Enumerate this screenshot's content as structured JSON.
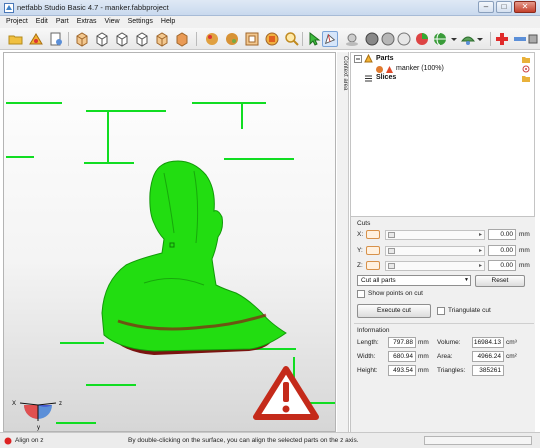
{
  "window": {
    "title": "netfabb Studio Basic 4.7 - manker.fabbproject",
    "buttons": {
      "minimize": "–",
      "maximize": "□",
      "close": "✕"
    }
  },
  "menu": {
    "items": [
      "Project",
      "Edit",
      "Part",
      "Extras",
      "View",
      "Settings",
      "Help"
    ]
  },
  "toolbar": {
    "icons": [
      "open-folder-icon",
      "add-part-icon",
      "new-project-icon",
      "view-front-icon",
      "view-back-icon",
      "view-left-icon",
      "view-right-icon",
      "view-top-icon",
      "view-bottom-icon",
      "repair-icon",
      "measure-icon",
      "slice-icon",
      "analysis-icon",
      "zoom-icon",
      "select-arrow-icon",
      "pointer-icon",
      "shading-icon",
      "solid-icon",
      "texture-icon",
      "wire-icon",
      "color-sphere-icon",
      "globe-icon",
      "palette-icon",
      "add-icon",
      "remove-icon",
      "settings-icon"
    ]
  },
  "sidebar_tab": {
    "label": "Context area"
  },
  "tree": {
    "parts_label": "Parts",
    "part_item": "manker (100%)",
    "slices_label": "Slices"
  },
  "cuts": {
    "heading": "Cuts",
    "axes": [
      {
        "axis": "X:",
        "value": "0.00",
        "unit": "mm"
      },
      {
        "axis": "Y:",
        "value": "0.00",
        "unit": "mm"
      },
      {
        "axis": "Z:",
        "value": "0.00",
        "unit": "mm"
      }
    ],
    "mode_select": "Cut all parts",
    "reset_button": "Reset",
    "show_points_label": "Show points on cut",
    "execute_button": "Execute cut",
    "triangulate_label": "Triangulate cut"
  },
  "information": {
    "heading": "Information",
    "length": {
      "label": "Length:",
      "value": "797.88",
      "unit": "mm"
    },
    "width": {
      "label": "Width:",
      "value": "680.94",
      "unit": "mm"
    },
    "height": {
      "label": "Height:",
      "value": "493.54",
      "unit": "mm"
    },
    "volume": {
      "label": "Volume:",
      "value": "16984.13",
      "unit": "cm³"
    },
    "area": {
      "label": "Area:",
      "value": "4966.24",
      "unit": "cm²"
    },
    "triangles": {
      "label": "Triangles:",
      "value": "385261"
    }
  },
  "axes_gizmo": {
    "x": "X",
    "y": "y",
    "z": "z"
  },
  "status": {
    "mode": "Align on z",
    "message": "By double-clicking on the surface, you can align the selected parts on the z axis."
  },
  "colors": {
    "model_green": "#22dd11",
    "model_underside": "#7a1410",
    "warning_red": "#c42a1a",
    "grid_green": "#11dd22"
  }
}
